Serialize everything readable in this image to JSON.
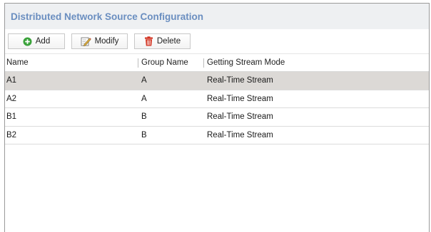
{
  "window": {
    "title": "Distributed Network Source Configuration"
  },
  "toolbar": {
    "add_label": "Add",
    "modify_label": "Modify",
    "delete_label": "Delete",
    "add_icon": "plus-circle-icon",
    "modify_icon": "pencil-icon",
    "delete_icon": "trash-icon",
    "add_icon_color": "#3aa23a",
    "delete_icon_color": "#d2311f"
  },
  "table": {
    "columns": [
      "Name",
      "Group Name",
      "Getting Stream Mode"
    ],
    "rows": [
      {
        "name": "A1",
        "group": "A",
        "mode": "Real-Time Stream",
        "selected": true
      },
      {
        "name": "A2",
        "group": "A",
        "mode": "Real-Time Stream",
        "selected": false
      },
      {
        "name": "B1",
        "group": "B",
        "mode": "Real-Time Stream",
        "selected": false
      },
      {
        "name": "B2",
        "group": "B",
        "mode": "Real-Time Stream",
        "selected": false
      }
    ]
  },
  "colors": {
    "title_text": "#6a8ec0",
    "title_bar_bg": "#eef0f2",
    "selected_row_bg": "#dcd9d6"
  }
}
